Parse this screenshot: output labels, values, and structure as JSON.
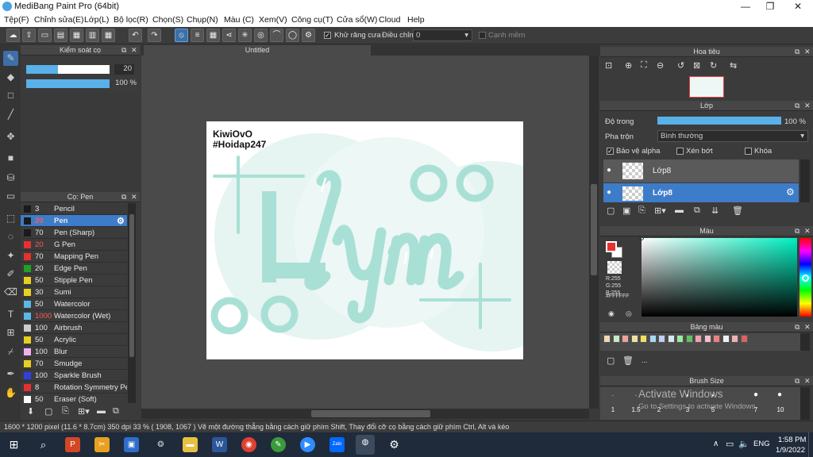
{
  "window": {
    "title": "MediBang Paint Pro (64bit)"
  },
  "menu": [
    "Tệp(F)",
    "Chỉnh sửa(E)",
    "Lớp(L)",
    "Bộ lọc(R)",
    "Chọn(S)",
    "Chụp(N)",
    "Màu (C)",
    "Xem(V)",
    "Công cụ(T)",
    "Cửa sổ(W)",
    "Cloud",
    "Help"
  ],
  "toolbar": {
    "antialias_label": "Khử răng cưa",
    "adjust_label": "Điều chỉnh",
    "adjust_value": "0",
    "edge_label": "Cạnh mềm"
  },
  "brush_control": {
    "title": "Kiểm soát cọ",
    "size_value": "20",
    "opacity_value": "100 %",
    "size_fraction": 0.38,
    "opacity_fraction": 1.0
  },
  "brush_panel": {
    "title": "Cọ: Pen",
    "items": [
      {
        "size": "3",
        "name": "Pencil",
        "color": "#1a1a1a",
        "size_color": "#e8e8e8"
      },
      {
        "size": "20",
        "name": "Pen",
        "color": "#1a1a1a",
        "size_color": "#ff5a5a",
        "selected": true
      },
      {
        "size": "70",
        "name": "Pen (Sharp)",
        "color": "#1a1a1a",
        "size_color": "#e8e8e8"
      },
      {
        "size": "20",
        "name": "G Pen",
        "color": "#e83030",
        "size_color": "#ff5a5a"
      },
      {
        "size": "70",
        "name": "Mapping Pen",
        "color": "#e83030",
        "size_color": "#e8e8e8"
      },
      {
        "size": "20",
        "name": "Edge Pen",
        "color": "#22a022",
        "size_color": "#e8e8e8"
      },
      {
        "size": "50",
        "name": "Stipple Pen",
        "color": "#e8d020",
        "size_color": "#e8e8e8"
      },
      {
        "size": "30",
        "name": "Sumi",
        "color": "#e8d020",
        "size_color": "#e8e8e8"
      },
      {
        "size": "50",
        "name": "Watercolor",
        "color": "#5ab8e8",
        "size_color": "#e8e8e8"
      },
      {
        "size": "1000",
        "name": "Watercolor (Wet)",
        "color": "#5ab8e8",
        "size_color": "#ff5a5a"
      },
      {
        "size": "100",
        "name": "Airbrush",
        "color": "#cccccc",
        "size_color": "#e8e8e8"
      },
      {
        "size": "50",
        "name": "Acrylic",
        "color": "#e8d020",
        "size_color": "#e8e8e8"
      },
      {
        "size": "100",
        "name": "Blur",
        "color": "#f0b0f0",
        "size_color": "#e8e8e8"
      },
      {
        "size": "70",
        "name": "Smudge",
        "color": "#e8d020",
        "size_color": "#e8e8e8"
      },
      {
        "size": "100",
        "name": "Sparkle Brush",
        "color": "#3040e0",
        "size_color": "#e8e8e8"
      },
      {
        "size": "8",
        "name": "Rotation Symmetry Pen",
        "color": "#e83030",
        "size_color": "#e8e8e8"
      },
      {
        "size": "50",
        "name": "Eraser (Soft)",
        "color": "#ffffff",
        "size_color": "#e8e8e8"
      }
    ]
  },
  "document": {
    "tab": "Untitled",
    "watermark_line1": "KiwiOvO",
    "watermark_line2": "#Hoidap247"
  },
  "navigator": {
    "title": "Hoa tiêu"
  },
  "layers": {
    "title": "Lớp",
    "opacity_label": "Độ trong",
    "opacity_value": "100 %",
    "opacity_fraction": 1.0,
    "blend_label": "Pha trộn",
    "blend_value": "Bình thường",
    "protect_alpha": "Bảo vệ alpha",
    "clipping": "Xén bớt",
    "lock": "Khóa",
    "items": [
      {
        "name": "Lớp8"
      },
      {
        "name": "Lớp8",
        "selected": true
      }
    ]
  },
  "color": {
    "title": "Màu",
    "r": "R:255",
    "g": "G:255",
    "b": "B:255",
    "hex": "#FFFFFF",
    "primary": "#e83030",
    "secondary": "#ffffff"
  },
  "palette": {
    "title": "Bảng màu",
    "swatches": [
      "#f0d8b0",
      "#c8e8c8",
      "#f0a0a0",
      "#f0e0a0",
      "#f0e060",
      "#a8d8f0",
      "#c0d0f0",
      "#d8e8f0",
      "#a0e8a0",
      "#60c060",
      "#f0a0b0",
      "#f0c0d0",
      "#f08080",
      "#f0f0f0",
      "#f0b0b0",
      "#e06060"
    ],
    "dots": "..."
  },
  "brush_size": {
    "title": "Brush Size",
    "labels": [
      "1",
      "1.5",
      "2",
      "3",
      "5",
      "7",
      "10"
    ]
  },
  "activation": {
    "line1": "Activate Windows",
    "line2": "Go to Settings to activate Windows."
  },
  "status": {
    "text": "1600 * 1200 pixel  (11.6 * 8.7cm)  350 dpi  33 %  ( 1908, 1067 )  Vẽ một đường thẳng bằng cách giữ phím Shift, Thay đổi cỡ cọ bằng cách giữ phím Ctrl, Alt và kéo"
  },
  "taskbar": {
    "lang": "ENG",
    "time": "1:58 PM",
    "date": "1/9/2022"
  }
}
